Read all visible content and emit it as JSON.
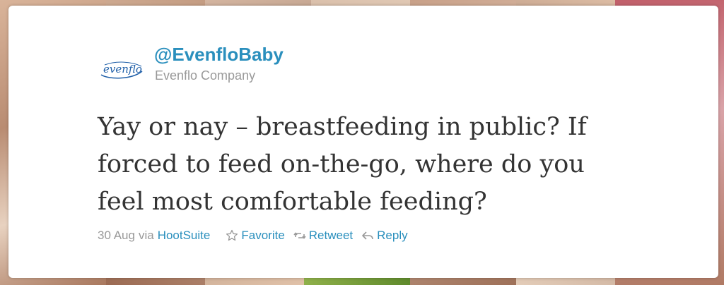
{
  "tweet": {
    "handle": "@EvenfloBaby",
    "full_name": "Evenflo Company",
    "logo_text": "evenflo",
    "text": "Yay or nay – breastfeeding in public? If forced to feed on-the-go, where do you feel most comfortable feeding?",
    "date": "30 Aug",
    "via_label": "via",
    "source": "HootSuite",
    "actions": {
      "favorite": "Favorite",
      "retweet": "Retweet",
      "reply": "Reply"
    }
  },
  "colors": {
    "link": "#2a8fbd",
    "muted": "#999999",
    "text": "#333333",
    "logo": "#1f5fa8"
  },
  "icons": {
    "favorite": "star-outline-icon",
    "retweet": "retweet-icon",
    "reply": "reply-arrow-icon"
  }
}
